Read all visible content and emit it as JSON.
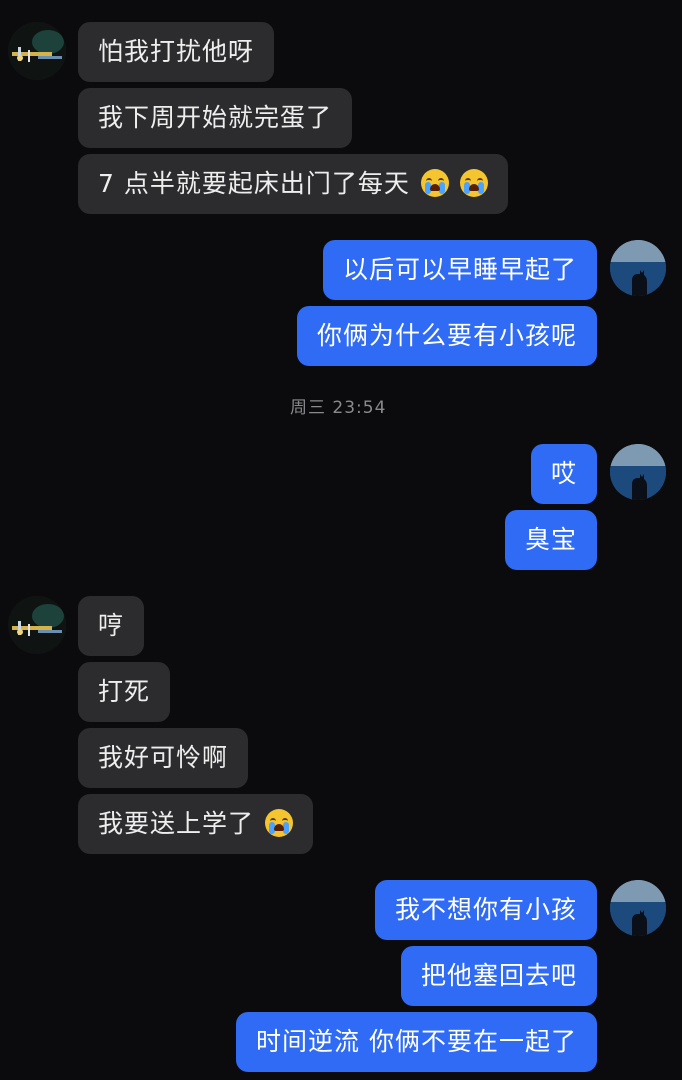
{
  "messages": [
    {
      "side": "received",
      "text": "怕我打扰他呀",
      "emoji_count": 0
    },
    {
      "side": "received",
      "text": "我下周开始就完蛋了",
      "emoji_count": 0
    },
    {
      "side": "received",
      "text": "7 点半就要起床出门了每天",
      "emoji_count": 2
    },
    {
      "side": "sent",
      "text": "以后可以早睡早起了"
    },
    {
      "side": "sent",
      "text": "你俩为什么要有小孩呢"
    },
    {
      "side": "sent",
      "text": "哎"
    },
    {
      "side": "sent",
      "text": "臭宝"
    },
    {
      "side": "received",
      "text": "哼",
      "emoji_count": 0
    },
    {
      "side": "received",
      "text": "打死",
      "emoji_count": 0
    },
    {
      "side": "received",
      "text": "我好可怜啊",
      "emoji_count": 0
    },
    {
      "side": "received",
      "text": "我要送上学了",
      "emoji_count": 1
    },
    {
      "side": "sent",
      "text": "我不想你有小孩"
    },
    {
      "side": "sent",
      "text": "把他塞回去吧"
    },
    {
      "side": "sent",
      "text": "时间逆流 你俩不要在一起了"
    }
  ],
  "timestamp": "周三 23:54",
  "emoji": {
    "name": "loudly-crying-face-icon"
  },
  "colors": {
    "background": "#0b0b0d",
    "received_bubble": "#2c2c2f",
    "sent_bubble": "#2f6bf5",
    "timestamp_text": "#8a8a8d"
  }
}
